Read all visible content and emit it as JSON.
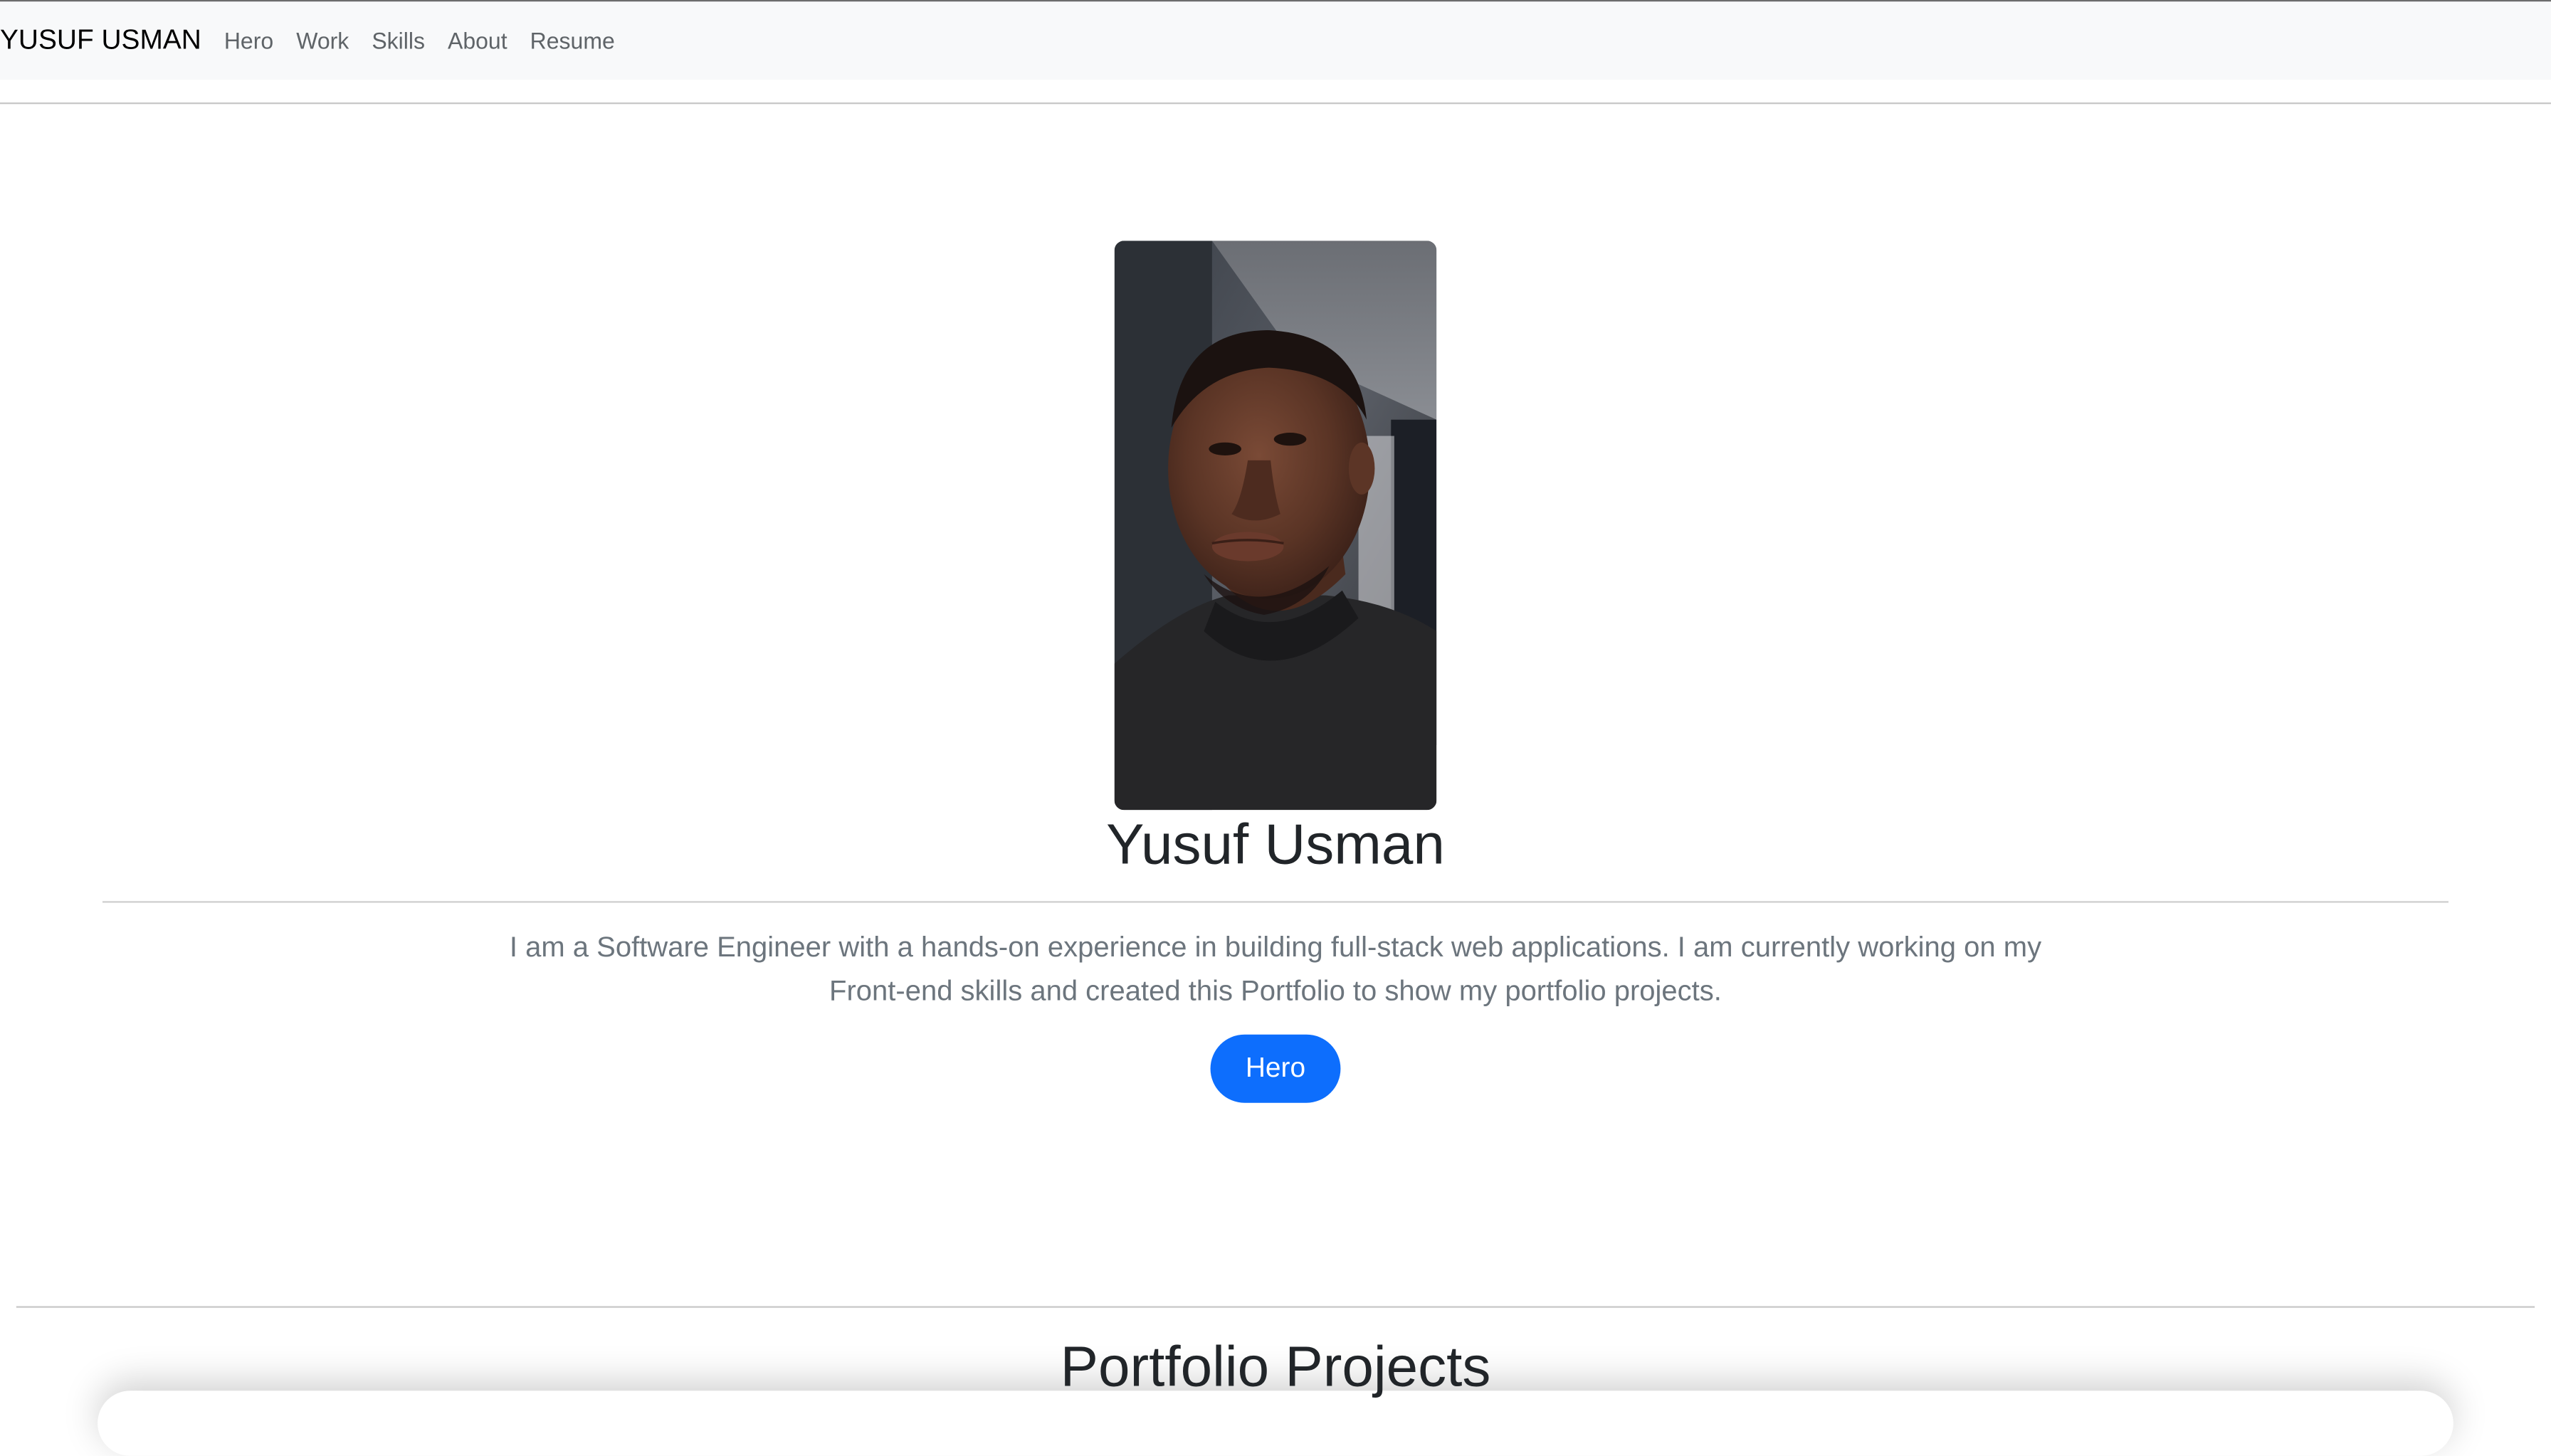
{
  "navbar": {
    "brand": "YUSUF USMAN",
    "links": [
      "Hero",
      "Work",
      "Skills",
      "About",
      "Resume"
    ]
  },
  "hero": {
    "name": "Yusuf Usman",
    "description": "I am a Software Engineer with a hands-on experience in building full-stack web applications. I am currently working on my Front-end skills and created this Portfolio to show my portfolio projects.",
    "button_label": "Hero"
  },
  "projects": {
    "title": "Portfolio Projects"
  },
  "colors": {
    "accent": "#0d6efd",
    "navbar_bg": "#f8f9fa",
    "muted_text": "#6c757d"
  }
}
